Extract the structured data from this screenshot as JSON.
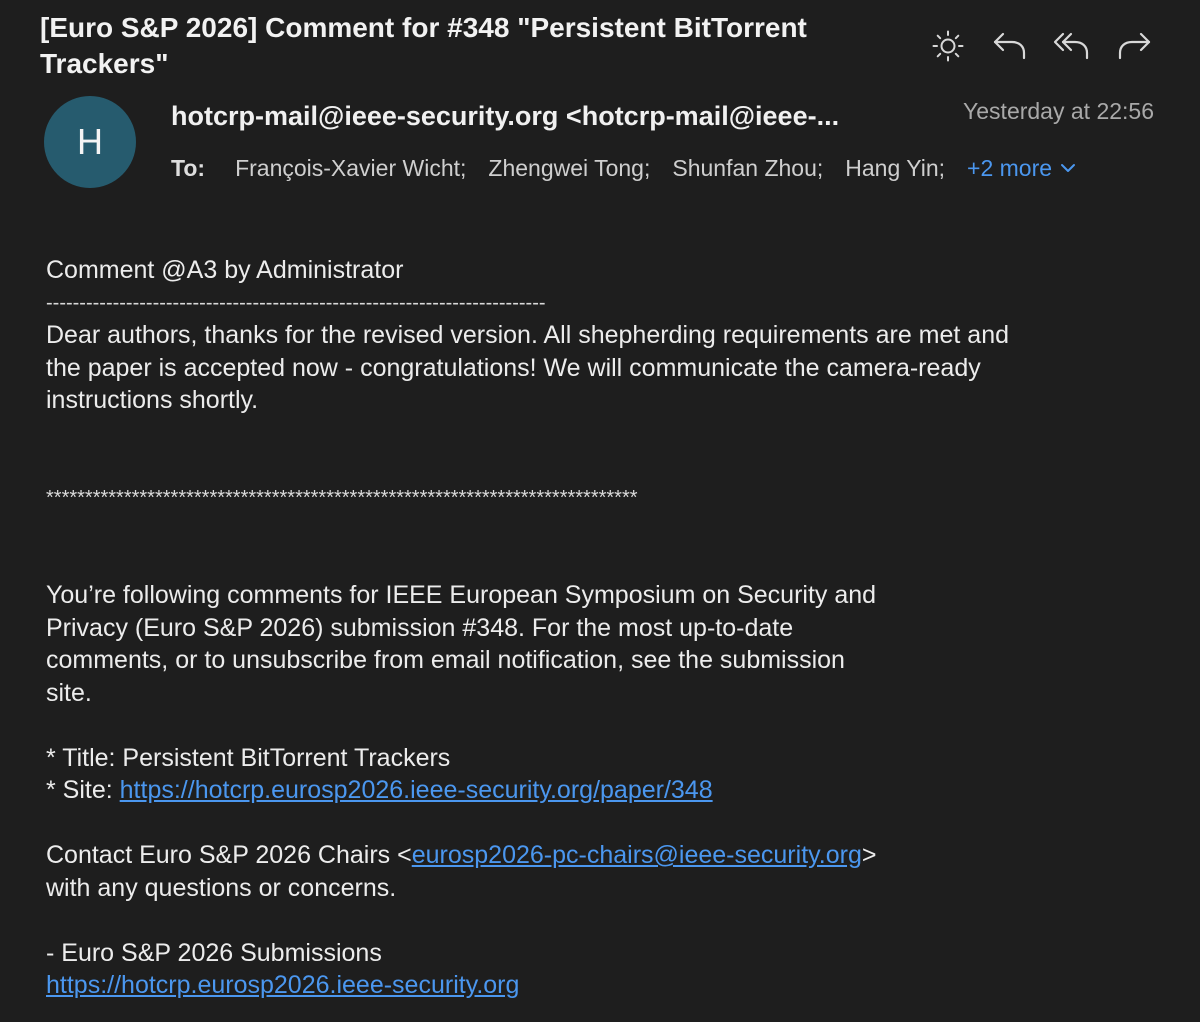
{
  "email": {
    "subject": "[Euro S&P 2026] Comment for #348 \"Persistent BitTorrent Trackers\"",
    "sender": "hotcrp-mail@ieee-security.org <hotcrp-mail@ieee-...",
    "avatar_initial": "H",
    "timestamp": "Yesterday at 22:56",
    "to_label": "To:",
    "recipients": [
      "François-Xavier Wicht;",
      "Zhengwei Tong;",
      "Shunfan Zhou;",
      "Hang Yin;"
    ],
    "more_label": "+2 more"
  },
  "toolbar": {
    "icons": [
      "brightness-icon",
      "reply-icon",
      "reply-all-icon",
      "forward-icon"
    ]
  },
  "body": {
    "heading": "Comment @A3 by Administrator",
    "dash_separator": "---------------------------------------------------------------------------",
    "message_line1": "Dear authors, thanks for the revised version. All shepherding requirements are met and",
    "message_line2": "the paper is accepted now - congratulations! We will communicate the camera-ready",
    "message_line3": "instructions shortly.",
    "star_separator": "****************************************************************************",
    "following_line1": "You’re following comments for IEEE European Symposium on Security and",
    "following_line2": "Privacy (Euro S&P 2026) submission #348. For the most up-to-date",
    "following_line3": "comments, or to unsubscribe from email notification, see the submission",
    "following_line4": "site.",
    "title_line": "* Title: Persistent BitTorrent Trackers",
    "site_prefix": "* Site: ",
    "site_url": "https://hotcrp.eurosp2026.ieee-security.org/paper/348",
    "contact_prefix": "Contact Euro S&P 2026 Chairs <",
    "contact_email": "eurosp2026-pc-chairs@ieee-security.org",
    "contact_suffix": ">",
    "contact_line2": "with any questions or concerns.",
    "signature": "- Euro S&P 2026 Submissions",
    "signature_url": "https://hotcrp.eurosp2026.ieee-security.org"
  },
  "colors": {
    "background": "#1e1e1e",
    "link": "#4b97ef",
    "avatar": "#265b6e"
  }
}
